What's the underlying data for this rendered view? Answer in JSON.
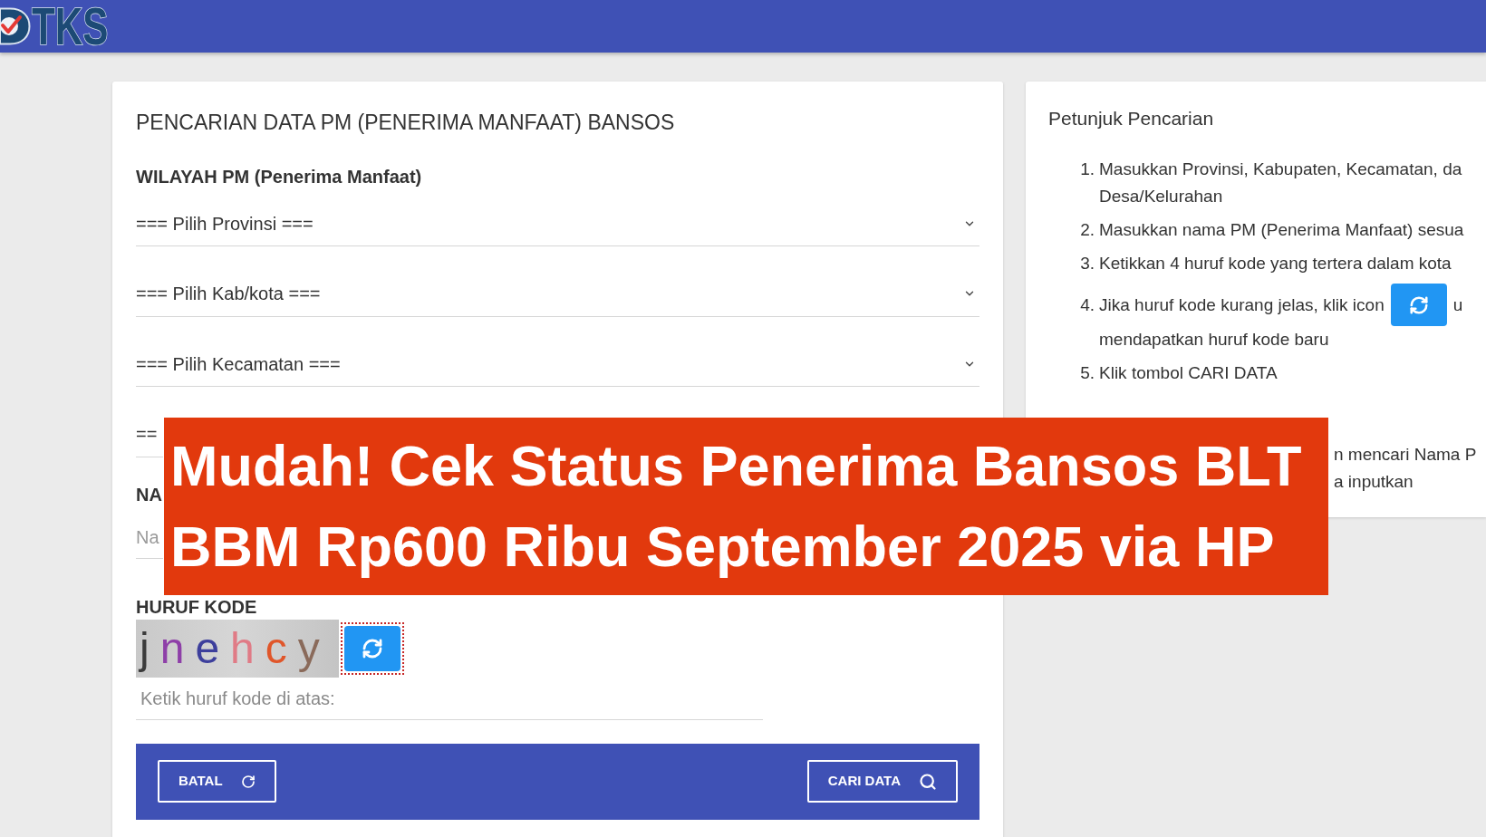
{
  "header": {
    "logo_text": "TKS"
  },
  "search_form": {
    "title": "PENCARIAN DATA PM (PENERIMA MANFAAT) BANSOS",
    "region_label": "WILAYAH PM (Penerima Manfaat)",
    "region_selects": [
      {
        "value": "=== Pilih Provinsi ===",
        "kind": "select"
      },
      {
        "value": "=== Pilih Kab/kota ===",
        "kind": "select"
      },
      {
        "value": "=== Pilih Kecamatan ===",
        "kind": "select"
      },
      {
        "value": "==",
        "kind": "select_partial"
      }
    ],
    "name_field": {
      "label": "NA",
      "placeholder": "Na"
    },
    "captcha": {
      "label": "HURUF KODE",
      "code": "jnehcy",
      "refresh_focused": true,
      "input_placeholder": "Ketik huruf kode di atas:"
    },
    "actions": [
      {
        "label": "BATAL",
        "kind": "reset"
      },
      {
        "label": "CARI DATA",
        "kind": "search"
      }
    ]
  },
  "instructions": {
    "title": "Petunjuk Pencarian",
    "steps": [
      {
        "number": "1.",
        "segments": [
          {
            "kind": "text",
            "lines": [
              "Masukkan Provinsi, Kabupaten, Kecamatan, da",
              "Desa/Kelurahan"
            ]
          }
        ]
      },
      {
        "number": "2.",
        "segments": [
          {
            "kind": "text",
            "lines": [
              "Masukkan nama PM (Penerima Manfaat) sesua"
            ]
          }
        ]
      },
      {
        "number": "3.",
        "segments": [
          {
            "kind": "text",
            "lines": [
              "Ketikkan 4 huruf kode yang tertera dalam kota"
            ]
          }
        ]
      },
      {
        "number": "4.",
        "segments": [
          {
            "kind": "text",
            "lines": [
              "Jika huruf kode kurang jelas, klik icon"
            ]
          },
          {
            "kind": "refresh_icon"
          },
          {
            "kind": "text",
            "lines": [
              "u"
            ]
          },
          {
            "kind": "text",
            "lines": [
              "mendapatkan huruf kode baru"
            ]
          }
        ]
      },
      {
        "number": "5.",
        "segments": [
          {
            "kind": "text",
            "lines": [
              "Klik tombol CARI DATA"
            ]
          }
        ]
      }
    ],
    "note": {
      "lines": [
        "n mencari Nama P",
        "a inputkan"
      ]
    }
  },
  "headline_banner": {
    "lines": [
      "Mudah! Cek Status Penerima Bansos BLT",
      "BBM Rp600 Ribu September 2025 via HP"
    ]
  }
}
